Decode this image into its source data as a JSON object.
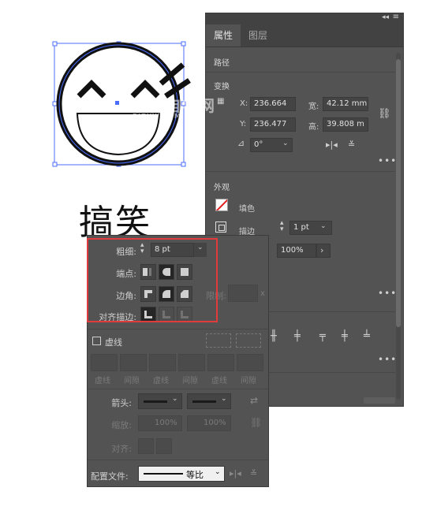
{
  "artwork": {
    "caption": "搞笑"
  },
  "watermark": {
    "text": "软件自学网",
    "sub": "RJZXW.COM"
  },
  "properties": {
    "tabs": [
      "属性",
      "图层"
    ],
    "path_label": "路径",
    "transform_title": "变换",
    "x_label": "X:",
    "x_value": "236.664",
    "y_label": "Y:",
    "y_value": "236.477",
    "w_label": "宽:",
    "w_value": "42.12 mm",
    "h_label": "高:",
    "h_value": "39.808 m",
    "angle_value": "0°",
    "appearance_title": "外观",
    "fill_label": "填色",
    "stroke_label": "描边",
    "stroke_weight": "1 pt",
    "opacity_value": "100%"
  },
  "stroke_panel": {
    "weight_label": "粗细:",
    "weight_value": "8 pt",
    "cap_label": "端点:",
    "corner_label": "边角:",
    "limit_label": "限制:",
    "limit_unit": "x",
    "align_label": "对齐描边:",
    "dashed_label": "虚线",
    "dash_labels": [
      "虚线",
      "间隙",
      "虚线",
      "间隙",
      "虚线",
      "间隙"
    ],
    "arrow_label": "箭头:",
    "scale_label": "缩放:",
    "scale_values": [
      "100%",
      "100%"
    ],
    "align2_label": "对齐:",
    "profile_label": "配置文件:",
    "profile_value": "等比"
  }
}
